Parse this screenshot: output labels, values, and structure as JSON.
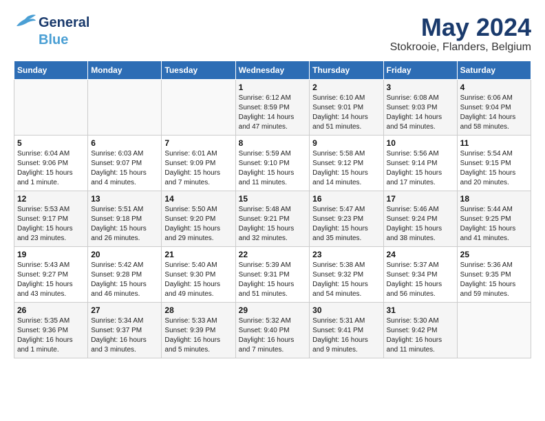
{
  "header": {
    "logo_general": "General",
    "logo_blue": "Blue",
    "month_title": "May 2024",
    "subtitle": "Stokrooie, Flanders, Belgium"
  },
  "days_of_week": [
    "Sunday",
    "Monday",
    "Tuesday",
    "Wednesday",
    "Thursday",
    "Friday",
    "Saturday"
  ],
  "weeks": [
    [
      {
        "day": "",
        "info": ""
      },
      {
        "day": "",
        "info": ""
      },
      {
        "day": "",
        "info": ""
      },
      {
        "day": "1",
        "info": "Sunrise: 6:12 AM\nSunset: 8:59 PM\nDaylight: 14 hours and 47 minutes."
      },
      {
        "day": "2",
        "info": "Sunrise: 6:10 AM\nSunset: 9:01 PM\nDaylight: 14 hours and 51 minutes."
      },
      {
        "day": "3",
        "info": "Sunrise: 6:08 AM\nSunset: 9:03 PM\nDaylight: 14 hours and 54 minutes."
      },
      {
        "day": "4",
        "info": "Sunrise: 6:06 AM\nSunset: 9:04 PM\nDaylight: 14 hours and 58 minutes."
      }
    ],
    [
      {
        "day": "5",
        "info": "Sunrise: 6:04 AM\nSunset: 9:06 PM\nDaylight: 15 hours and 1 minute."
      },
      {
        "day": "6",
        "info": "Sunrise: 6:03 AM\nSunset: 9:07 PM\nDaylight: 15 hours and 4 minutes."
      },
      {
        "day": "7",
        "info": "Sunrise: 6:01 AM\nSunset: 9:09 PM\nDaylight: 15 hours and 7 minutes."
      },
      {
        "day": "8",
        "info": "Sunrise: 5:59 AM\nSunset: 9:10 PM\nDaylight: 15 hours and 11 minutes."
      },
      {
        "day": "9",
        "info": "Sunrise: 5:58 AM\nSunset: 9:12 PM\nDaylight: 15 hours and 14 minutes."
      },
      {
        "day": "10",
        "info": "Sunrise: 5:56 AM\nSunset: 9:14 PM\nDaylight: 15 hours and 17 minutes."
      },
      {
        "day": "11",
        "info": "Sunrise: 5:54 AM\nSunset: 9:15 PM\nDaylight: 15 hours and 20 minutes."
      }
    ],
    [
      {
        "day": "12",
        "info": "Sunrise: 5:53 AM\nSunset: 9:17 PM\nDaylight: 15 hours and 23 minutes."
      },
      {
        "day": "13",
        "info": "Sunrise: 5:51 AM\nSunset: 9:18 PM\nDaylight: 15 hours and 26 minutes."
      },
      {
        "day": "14",
        "info": "Sunrise: 5:50 AM\nSunset: 9:20 PM\nDaylight: 15 hours and 29 minutes."
      },
      {
        "day": "15",
        "info": "Sunrise: 5:48 AM\nSunset: 9:21 PM\nDaylight: 15 hours and 32 minutes."
      },
      {
        "day": "16",
        "info": "Sunrise: 5:47 AM\nSunset: 9:23 PM\nDaylight: 15 hours and 35 minutes."
      },
      {
        "day": "17",
        "info": "Sunrise: 5:46 AM\nSunset: 9:24 PM\nDaylight: 15 hours and 38 minutes."
      },
      {
        "day": "18",
        "info": "Sunrise: 5:44 AM\nSunset: 9:25 PM\nDaylight: 15 hours and 41 minutes."
      }
    ],
    [
      {
        "day": "19",
        "info": "Sunrise: 5:43 AM\nSunset: 9:27 PM\nDaylight: 15 hours and 43 minutes."
      },
      {
        "day": "20",
        "info": "Sunrise: 5:42 AM\nSunset: 9:28 PM\nDaylight: 15 hours and 46 minutes."
      },
      {
        "day": "21",
        "info": "Sunrise: 5:40 AM\nSunset: 9:30 PM\nDaylight: 15 hours and 49 minutes."
      },
      {
        "day": "22",
        "info": "Sunrise: 5:39 AM\nSunset: 9:31 PM\nDaylight: 15 hours and 51 minutes."
      },
      {
        "day": "23",
        "info": "Sunrise: 5:38 AM\nSunset: 9:32 PM\nDaylight: 15 hours and 54 minutes."
      },
      {
        "day": "24",
        "info": "Sunrise: 5:37 AM\nSunset: 9:34 PM\nDaylight: 15 hours and 56 minutes."
      },
      {
        "day": "25",
        "info": "Sunrise: 5:36 AM\nSunset: 9:35 PM\nDaylight: 15 hours and 59 minutes."
      }
    ],
    [
      {
        "day": "26",
        "info": "Sunrise: 5:35 AM\nSunset: 9:36 PM\nDaylight: 16 hours and 1 minute."
      },
      {
        "day": "27",
        "info": "Sunrise: 5:34 AM\nSunset: 9:37 PM\nDaylight: 16 hours and 3 minutes."
      },
      {
        "day": "28",
        "info": "Sunrise: 5:33 AM\nSunset: 9:39 PM\nDaylight: 16 hours and 5 minutes."
      },
      {
        "day": "29",
        "info": "Sunrise: 5:32 AM\nSunset: 9:40 PM\nDaylight: 16 hours and 7 minutes."
      },
      {
        "day": "30",
        "info": "Sunrise: 5:31 AM\nSunset: 9:41 PM\nDaylight: 16 hours and 9 minutes."
      },
      {
        "day": "31",
        "info": "Sunrise: 5:30 AM\nSunset: 9:42 PM\nDaylight: 16 hours and 11 minutes."
      },
      {
        "day": "",
        "info": ""
      }
    ]
  ]
}
